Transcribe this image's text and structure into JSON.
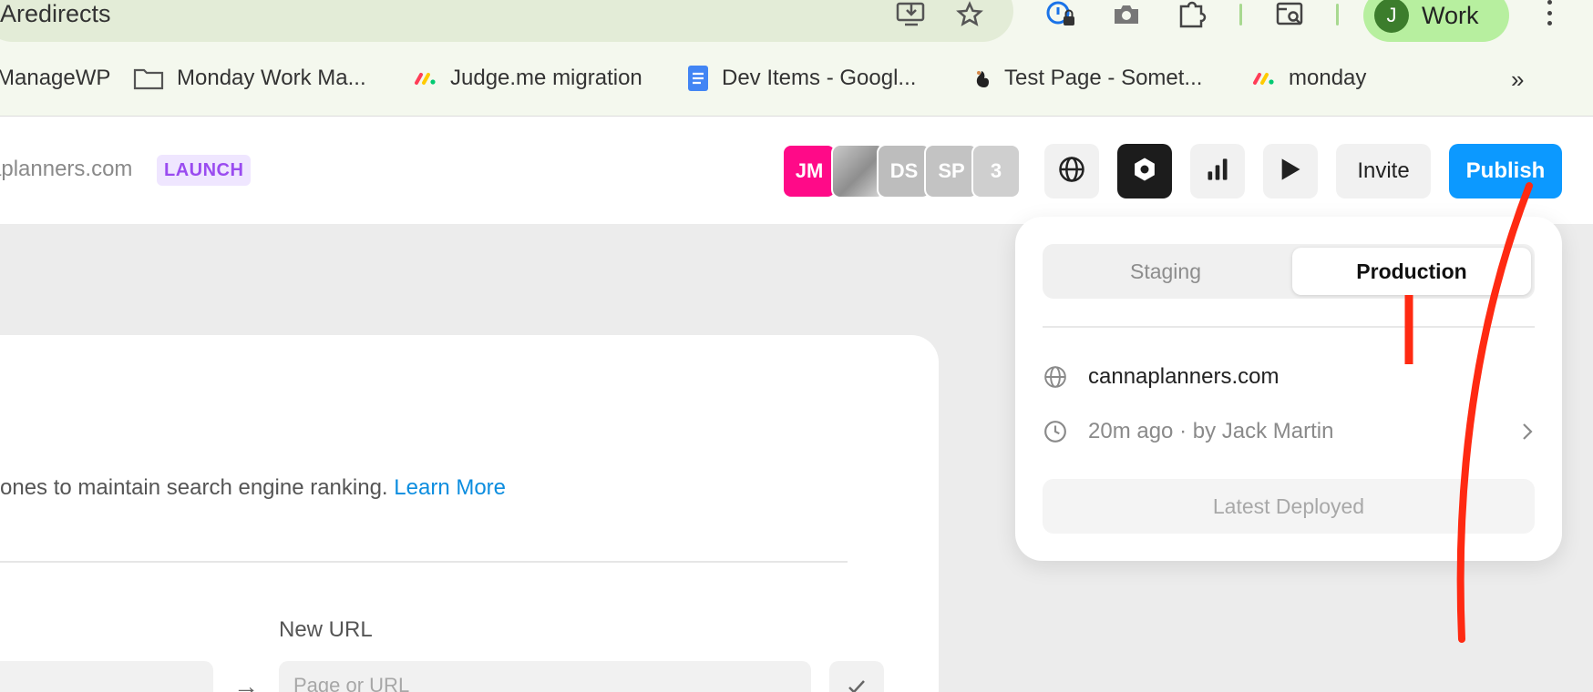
{
  "browser": {
    "omnibox_text": "Aredirects",
    "profile": {
      "initial": "J",
      "name": "Work"
    },
    "toolbar_icons": [
      "install-app-icon",
      "star-icon",
      "password-manager-icon",
      "camera-icon",
      "extensions-icon",
      "tab-search-icon"
    ],
    "bookmarks": [
      {
        "label": "ManageWP",
        "icon": "none"
      },
      {
        "label": "Monday Work Ma...",
        "icon": "folder-icon"
      },
      {
        "label": "Judge.me migration",
        "icon": "monday-logo-icon"
      },
      {
        "label": "Dev Items - Googl...",
        "icon": "google-docs-icon"
      },
      {
        "label": "Test Page - Somet...",
        "icon": "squirrel-icon"
      },
      {
        "label": "monday",
        "icon": "monday-logo-icon"
      }
    ],
    "bookmarks_more": "»"
  },
  "header": {
    "site_name": "aplanners.com",
    "badge": "LAUNCH",
    "collaborators": [
      {
        "initials": "JM",
        "color": "#ff0a88"
      },
      {
        "initials": "",
        "color": "#a9a9a9"
      },
      {
        "initials": "DS",
        "color": "#bdbdbd"
      },
      {
        "initials": "SP",
        "color": "#c3c3c3"
      },
      {
        "initials": "3",
        "color": "#cfcfcf"
      }
    ],
    "icon_buttons": [
      "globe-icon",
      "framer-logo-icon",
      "analytics-icon",
      "play-icon"
    ],
    "invite_label": "Invite",
    "publish_label": "Publish",
    "publish_color": "#0c99ff"
  },
  "main": {
    "description": "ones to maintain search engine ranking.",
    "learn_more": "Learn More",
    "new_url_label": "New URL",
    "new_url_placeholder": "Page or URL"
  },
  "popover": {
    "tabs": [
      {
        "label": "Staging",
        "active": false
      },
      {
        "label": "Production",
        "active": true
      }
    ],
    "domain": "cannaplanners.com",
    "deployed_info": "20m ago · by Jack Martin",
    "latest_button": "Latest Deployed"
  },
  "annotation_color": "#ff2a12"
}
